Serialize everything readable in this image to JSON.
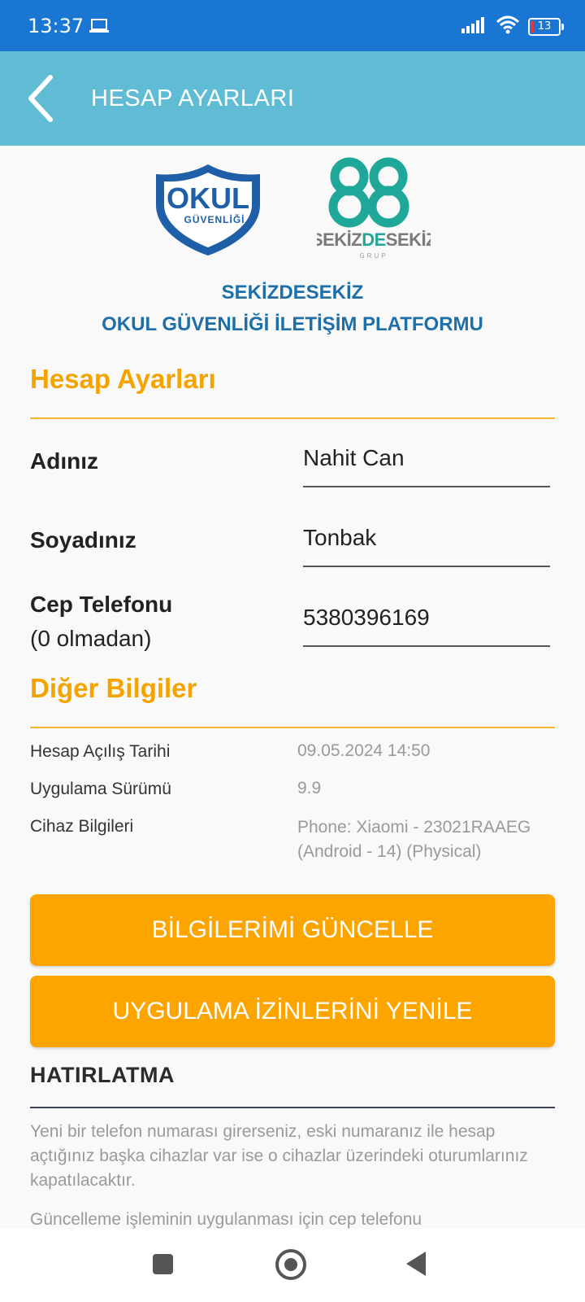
{
  "status_bar": {
    "time": "13:37",
    "battery": "13",
    "icons": [
      "laptop-icon",
      "signal-icon",
      "wifi-icon",
      "battery-icon"
    ]
  },
  "app_bar": {
    "title": "HESAP AYARLARI",
    "back_icon": "chevron-left-icon"
  },
  "logos": {
    "okul_line1": "OKUL",
    "okul_line2": "GÜVENLİĞİ",
    "brand_top": "88",
    "brand_name_a": "SEKİZ",
    "brand_name_b": "DE",
    "brand_name_c": "SEKİZ",
    "brand_sub": "GRUP"
  },
  "platform": {
    "line1": "SEKİZDESEKİZ",
    "line2": "OKUL GÜVENLİĞİ İLETİŞİM PLATFORMU"
  },
  "account_section": {
    "title": "Hesap Ayarları",
    "fields": [
      {
        "label": "Adınız",
        "value": "Nahit Can"
      },
      {
        "label": "Soyadınız",
        "value": "Tonbak"
      },
      {
        "label_line1": "Cep Telefonu",
        "label_line2": "(0 olmadan)",
        "value": "5380396169"
      }
    ]
  },
  "other_section": {
    "title": "Diğer Bilgiler",
    "rows": [
      {
        "label": "Hesap Açılış Tarihi",
        "value": "09.05.2024 14:50"
      },
      {
        "label": "Uygulama Sürümü",
        "value": "9.9"
      },
      {
        "label": "Cihaz Bilgileri",
        "value_line1": "Phone: Xiaomi - 23021RAAEG",
        "value_line2": "(Android - 14) (Physical)"
      }
    ]
  },
  "buttons": {
    "update": "BİLGİLERİMİ GÜNCELLE",
    "permissions": "UYGULAMA İZİNLERİNİ YENİLE"
  },
  "reminder": {
    "title": "HATIRLATMA",
    "paragraph1": "Yeni bir telefon numarası girerseniz, eski numaranız ile hesap açtığınız başka cihazlar var ise o cihazlar üzerindeki oturumlarınız kapatılacaktır.",
    "paragraph2": "Güncelleme işleminin uygulanması için cep telefonu"
  },
  "colors": {
    "status_bar": "#1976d2",
    "app_bar": "#5fbcd4",
    "accent": "#fca500",
    "platform_text": "#1e6fa8",
    "shield": "#1f5fa8",
    "teal": "#1fa89a"
  },
  "nav_bar": [
    "recents-square-icon",
    "home-circle-icon",
    "back-triangle-icon"
  ]
}
